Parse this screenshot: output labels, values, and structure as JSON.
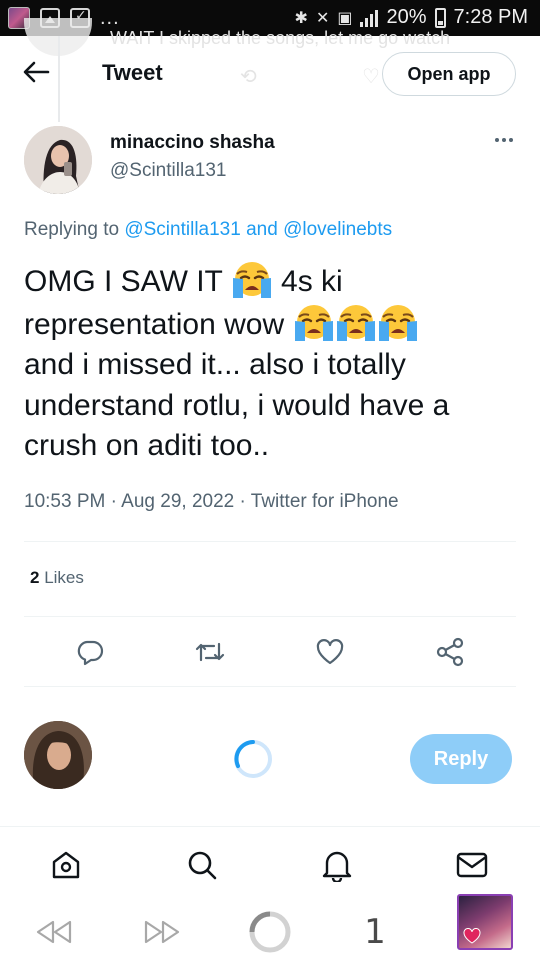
{
  "status_bar": {
    "battery": "20%",
    "time": "7:28 PM",
    "overflow": "..."
  },
  "background_tweet_text": "WAIT I skipped the songs, let me go watch",
  "header": {
    "title": "Tweet",
    "open_app_label": "Open app"
  },
  "author": {
    "name": "minaccino shasha",
    "handle": "@Scintilla131"
  },
  "replying": {
    "prefix": "Replying to",
    "handle1": "@Scintilla131",
    "joiner": "and",
    "handle2": "@lovelinebts"
  },
  "tweet": {
    "line1_a": "OMG I SAW IT",
    "line1_b": "4s ki",
    "line2": "representation wow",
    "line3": "and i missed it... also i totally",
    "line4": "understand rotlu, i would have a",
    "line5": "crush on aditi too..",
    "emoji": "loudly-crying-face"
  },
  "meta": {
    "time": "10:53 PM",
    "sep1": "·",
    "date": "Aug 29, 2022",
    "sep2": "·",
    "source": "Twitter for iPhone"
  },
  "likes": {
    "count": "2",
    "label": "Likes"
  },
  "actions": [
    "reply-icon",
    "retweet-icon",
    "like-icon",
    "share-icon"
  ],
  "reply_bar": {
    "button_label": "Reply"
  },
  "bottom_nav": [
    "home-icon",
    "search-icon",
    "notifications-icon",
    "messages-icon"
  ],
  "browser_bar": {
    "tab_count": "1"
  },
  "colors": {
    "accent": "#1d9bf0",
    "reply_button": "#8ecdf8",
    "text_primary": "#0f1419",
    "text_secondary": "#536471",
    "status_bar": "#0a0a0a"
  }
}
